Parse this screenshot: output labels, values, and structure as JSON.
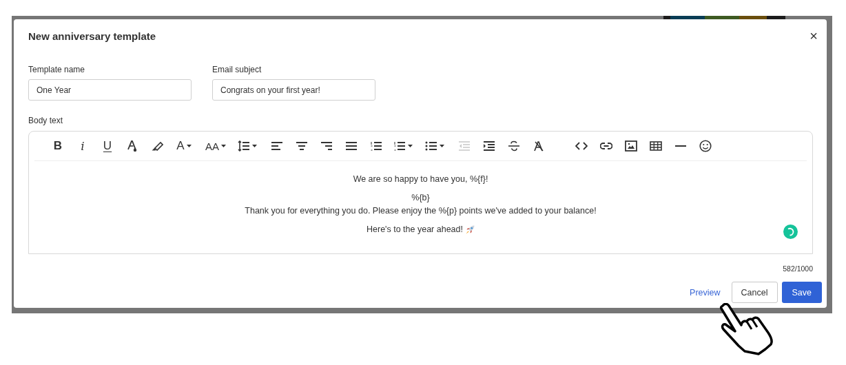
{
  "dialog": {
    "title": "New anniversary template",
    "close": "×"
  },
  "fields": [
    {
      "label": "Template name",
      "value": "One Year"
    },
    {
      "label": "Email subject",
      "value": "Congrats on your first year!"
    }
  ],
  "body": {
    "label": "Body text",
    "toolbar": [
      {
        "kind": "glyph",
        "label": "B",
        "has_menu": false,
        "disabled": false
      },
      {
        "kind": "glyph",
        "label": "i",
        "has_menu": false,
        "disabled": false
      },
      {
        "kind": "glyph",
        "label": "U",
        "has_menu": false,
        "disabled": false
      },
      {
        "kind": "icon",
        "has_menu": false,
        "disabled": false
      },
      {
        "kind": "icon",
        "has_menu": false,
        "disabled": false
      },
      {
        "kind": "glyph",
        "label": "A",
        "has_menu": true,
        "disabled": false
      },
      {
        "kind": "glyph",
        "label": "AA",
        "has_menu": true,
        "disabled": false
      },
      {
        "kind": "icon",
        "has_menu": true,
        "disabled": false
      },
      {
        "kind": "icon",
        "has_menu": false,
        "disabled": false
      },
      {
        "kind": "icon",
        "has_menu": false,
        "disabled": false
      },
      {
        "kind": "icon",
        "has_menu": false,
        "disabled": false
      },
      {
        "kind": "icon",
        "has_menu": false,
        "disabled": false
      },
      {
        "kind": "icon",
        "has_menu": false,
        "disabled": false
      },
      {
        "kind": "icon",
        "has_menu": true,
        "disabled": false
      },
      {
        "kind": "icon",
        "has_menu": true,
        "disabled": false
      },
      {
        "kind": "icon",
        "has_menu": false,
        "disabled": true
      },
      {
        "kind": "icon",
        "has_menu": false,
        "disabled": false
      },
      {
        "kind": "icon",
        "has_menu": false,
        "disabled": false
      },
      {
        "kind": "icon",
        "has_menu": false,
        "disabled": false
      },
      {
        "kind": "spacer"
      },
      {
        "kind": "icon",
        "has_menu": false,
        "disabled": false
      },
      {
        "kind": "icon",
        "has_menu": false,
        "disabled": false
      },
      {
        "kind": "icon",
        "has_menu": false,
        "disabled": false
      },
      {
        "kind": "icon",
        "has_menu": false,
        "disabled": false
      },
      {
        "kind": "icon",
        "has_menu": false,
        "disabled": false
      },
      {
        "kind": "icon",
        "has_menu": false,
        "disabled": false
      }
    ],
    "paragraphs": [
      {
        "lines": [
          "We are so happy to have you, %{f}!"
        ]
      },
      {
        "lines": [
          "%{b}",
          "Thank you for everything you do. Please enjoy the %{p} points we've added to your balance!"
        ]
      },
      {
        "lines": [
          "Here's to the year ahead!"
        ]
      }
    ],
    "counter": "582/1000"
  },
  "buttons": [
    {
      "label": "Preview",
      "kind": "link"
    },
    {
      "label": "Cancel",
      "kind": "secondary"
    },
    {
      "label": "Save",
      "kind": "primary"
    }
  ]
}
